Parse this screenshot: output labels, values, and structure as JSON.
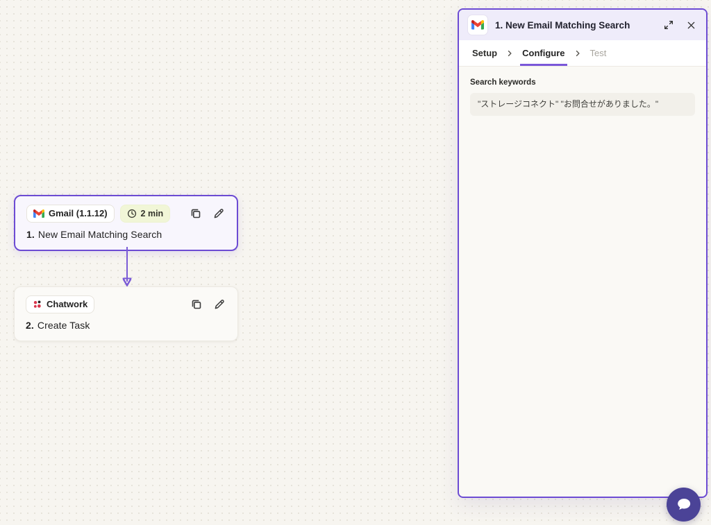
{
  "canvas": {
    "nodes": [
      {
        "app_chip": "Gmail (1.1.12)",
        "time_chip": "2 min",
        "title_prefix": "1.",
        "title": "New Email Matching Search"
      },
      {
        "app_chip": "Chatwork",
        "title_prefix": "2.",
        "title": "Create Task"
      }
    ]
  },
  "panel": {
    "header": {
      "title": "1. New Email Matching Search"
    },
    "tabs": [
      {
        "label": "Setup",
        "state": "default"
      },
      {
        "label": "Configure",
        "state": "active"
      },
      {
        "label": "Test",
        "state": "disabled"
      }
    ],
    "field": {
      "label": "Search keywords",
      "value": "\"ストレージコネクト\" \"お問合せがありました。\""
    }
  },
  "colors": {
    "accent_purple": "#6C4BD3",
    "arrow_purple": "#7B5BD6",
    "tab_underline": "#7A57D9",
    "canvas_bg": "#F7F5F0",
    "time_chip_bg": "#F1F6D7",
    "chat_fab_bg": "#4B4397",
    "chatwork_red": "#D8354B"
  }
}
